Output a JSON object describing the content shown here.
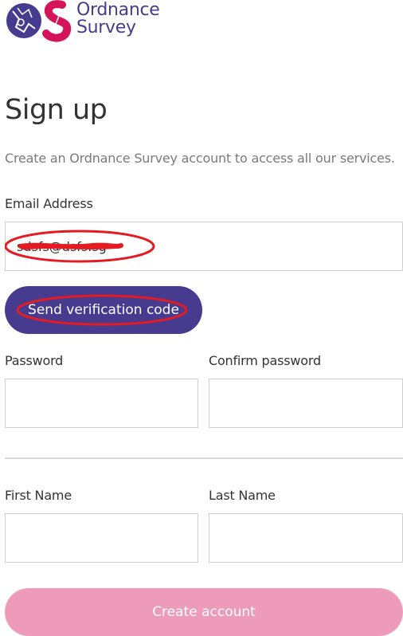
{
  "brand": {
    "line1": "Ordnance",
    "line2": "Survey",
    "colors": {
      "purple": "#453c90",
      "magenta": "#d4145a",
      "button_purple": "#463b8f",
      "button_disabled_pink": "#ee9bba"
    }
  },
  "page": {
    "title": "Sign up",
    "subtitle": "Create an Ordnance Survey account to access all our services."
  },
  "form": {
    "email": {
      "label": "Email Address",
      "value": "sdsfs@dsfs.sg"
    },
    "send_code_label": "Send verification code",
    "password": {
      "label": "Password",
      "value": ""
    },
    "confirm_password": {
      "label": "Confirm password",
      "value": ""
    },
    "first_name": {
      "label": "First Name",
      "value": ""
    },
    "last_name": {
      "label": "Last Name",
      "value": ""
    },
    "create_account_label": "Create account"
  },
  "annotations": {
    "scribble_color": "#e31b23"
  }
}
